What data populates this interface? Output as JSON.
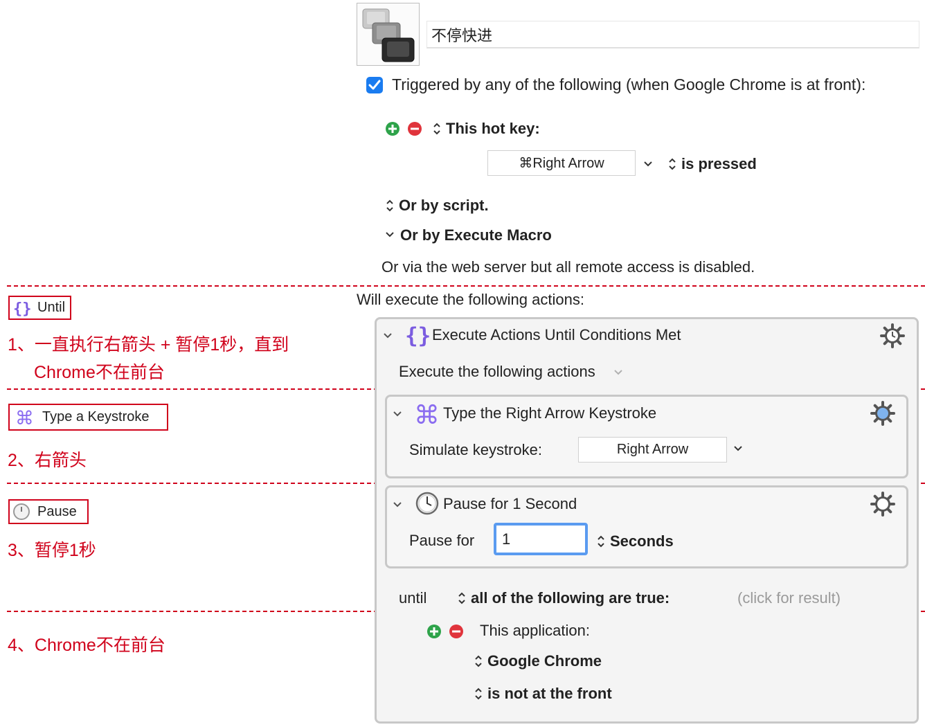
{
  "macro": {
    "name": "不停快进",
    "triggered_label": "Triggered by any of the following (when Google Chrome is at front):",
    "hotkey_label": "This hot key:",
    "hotkey_value": "⌘Right Arrow",
    "hotkey_state": "is pressed",
    "script_label": "Or by script.",
    "execute_macro_label": "Or by Execute Macro",
    "web_server_note": "Or via the web server but all remote access is disabled.",
    "actions_header": "Will execute the following actions:"
  },
  "until_action": {
    "title": "Execute Actions Until Conditions Met",
    "subtitle": "Execute the following actions",
    "until_label": "until",
    "condition_mode": "all of the following are true:",
    "click_result": "(click for result)",
    "app_condition_label": "This application:",
    "app_name": "Google Chrome",
    "app_state": "is not at the front"
  },
  "keystroke_action": {
    "title": "Type the Right Arrow Keystroke",
    "simulate_label": "Simulate keystroke:",
    "key_value": "Right Arrow"
  },
  "pause_action": {
    "title": "Pause for 1 Second",
    "pause_label": "Pause for",
    "pause_value": "1",
    "unit": "Seconds"
  },
  "annotations": {
    "until_chip": "Until",
    "step1_line1": "1、一直执行右箭头 + 暂停1秒，直到",
    "step1_line2": "Chrome不在前台",
    "keystroke_chip": "Type a Keystroke",
    "step2": "2、右箭头",
    "pause_chip": "Pause",
    "step3": "3、暂停1秒",
    "step4": "4、Chrome不在前台"
  },
  "colors": {
    "annotation_red": "#d0021b",
    "checkbox_blue": "#1a7cf0",
    "add_green": "#2ea34a",
    "remove_red": "#e0343c",
    "braces_purple": "#7b5ce0",
    "command_purple": "#8a6cf0",
    "focus_blue": "#5a9bf0"
  },
  "icons": {
    "macro_icon": "stacked-keys-icon",
    "checkbox": "checkbox-checked-icon",
    "add": "add-circle-icon",
    "remove": "remove-circle-icon",
    "updown": "updown-chevron-icon",
    "chevron": "chevron-down-icon",
    "gear": "gear-icon",
    "braces": "braces-icon",
    "command": "command-key-icon",
    "clock": "clock-icon"
  }
}
